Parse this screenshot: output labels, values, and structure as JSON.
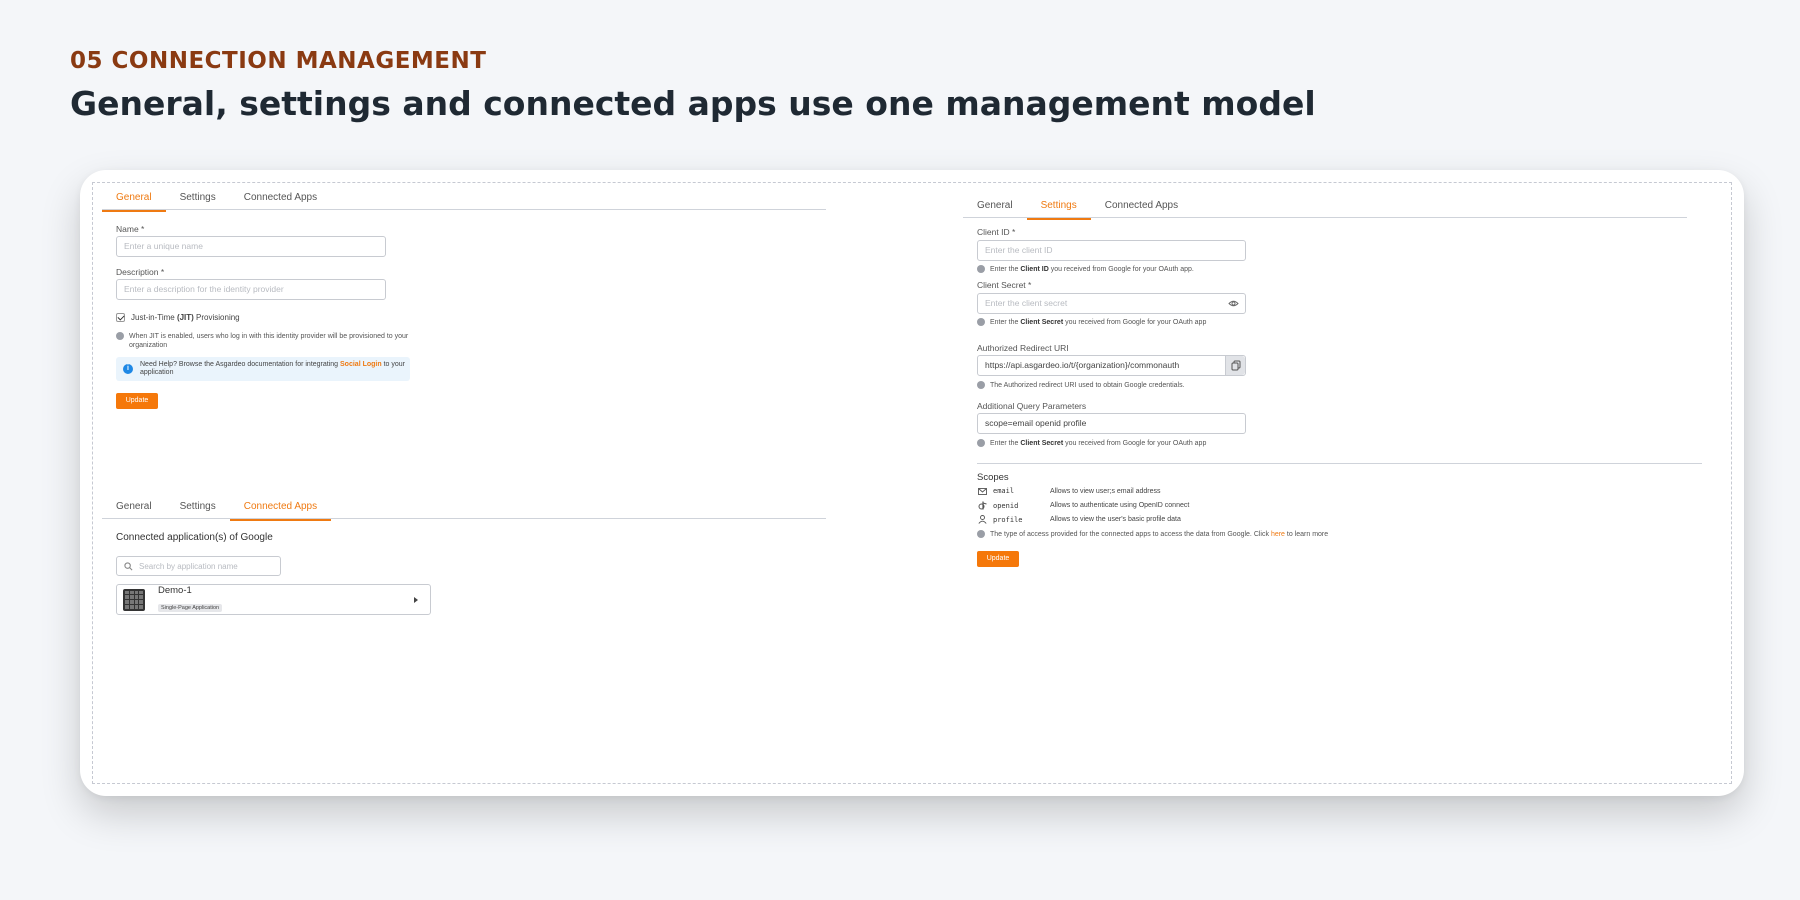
{
  "eyebrow": "05  CONNECTION MANAGEMENT",
  "headline": "General, settings and connected apps use one management model",
  "tabs": {
    "general": "General",
    "settings": "Settings",
    "connected_apps": "Connected Apps"
  },
  "general_panel": {
    "name_label": "Name *",
    "name_placeholder": "Enter a unique name",
    "description_label": "Description *",
    "description_placeholder": "Enter a description for the identity provider",
    "jit_label_pre": "Just-in-Time ",
    "jit_label_bold": "(JIT)",
    "jit_label_post": " Provisioning",
    "jit_hint": "When JIT is enabled, users who log in with this identity provider will be provisioned to your organization",
    "help_pre": "Need Help? Browse the Asgardeo documentation for integrating ",
    "help_link": "Social Login",
    "help_post": " to your application",
    "update": "Update"
  },
  "connected_panel": {
    "title": "Connected application(s) of Google",
    "search_placeholder": "Search by application name",
    "app_name": "Demo-1",
    "app_type": "Single-Page Application"
  },
  "settings_panel": {
    "client_id_label": "Client ID *",
    "client_id_placeholder": "Enter the client ID",
    "client_id_hint_pre": "Enter the ",
    "client_id_hint_bold": "Client ID",
    "client_id_hint_post": " you received from Google for your OAuth app.",
    "client_secret_label": "Client Secret *",
    "client_secret_placeholder": "Enter the client secret",
    "client_secret_hint_pre": "Enter the ",
    "client_secret_hint_bold": "Client Secret",
    "client_secret_hint_post": " you received from Google for your OAuth app",
    "redirect_label": "Authorized Redirect URI",
    "redirect_value": "https://api.asgardeo.io/t/{organization}/commonauth",
    "redirect_hint": "The Authorized redirect URI used to obtain Google credentials.",
    "query_label": "Additional Query Parameters",
    "query_value": "scope=email openid profile",
    "query_hint_pre": "Enter the ",
    "query_hint_bold": "Client Secret",
    "query_hint_post": " you received from Google for your OAuth app",
    "scopes_title": "Scopes",
    "scopes": [
      {
        "name": "email",
        "desc": "Allows to view user;s email address"
      },
      {
        "name": "openid",
        "desc": "Allows to authenticate using OpenID connect"
      },
      {
        "name": "profile",
        "desc": "Allows to view the user's basic profile data"
      }
    ],
    "scopes_hint_pre": "The type of access provided for the connected apps to access the data from Google. Click ",
    "scopes_hint_link": "here",
    "scopes_hint_post": " to learn more",
    "update": "Update"
  },
  "colors": {
    "accent": "#ef7a12",
    "eyebrow": "#8a3a12",
    "info": "#1f88e5"
  }
}
